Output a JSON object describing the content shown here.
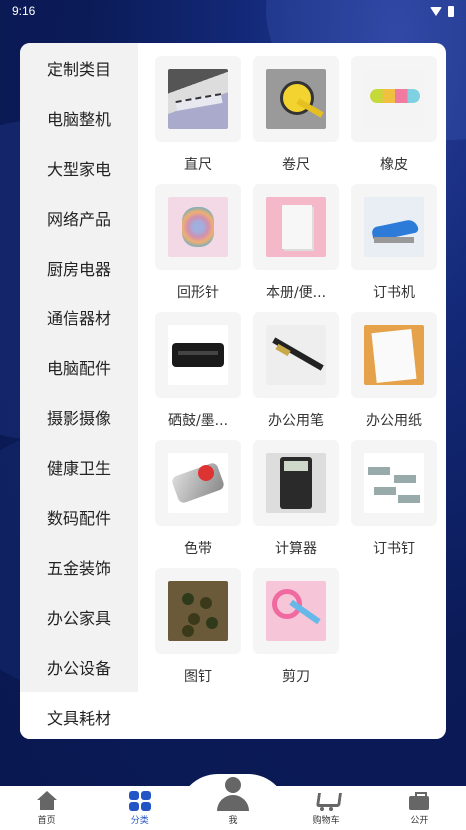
{
  "status_bar": {
    "time": "9:16"
  },
  "sidebar": {
    "items": [
      {
        "label": "定制类目"
      },
      {
        "label": "电脑整机"
      },
      {
        "label": "大型家电"
      },
      {
        "label": "网络产品"
      },
      {
        "label": "厨房电器"
      },
      {
        "label": "通信器材"
      },
      {
        "label": "电脑配件"
      },
      {
        "label": "摄影摄像"
      },
      {
        "label": "健康卫生"
      },
      {
        "label": "数码配件"
      },
      {
        "label": "五金装饰"
      },
      {
        "label": "办公家具"
      },
      {
        "label": "办公设备"
      },
      {
        "label": "文具耗材"
      }
    ],
    "active": "文具耗材"
  },
  "products": [
    {
      "label": "直尺",
      "icon": "ruler-image"
    },
    {
      "label": "卷尺",
      "icon": "tape-measure-image"
    },
    {
      "label": "橡皮",
      "icon": "eraser-image"
    },
    {
      "label": "回形针",
      "icon": "paper-clip-image"
    },
    {
      "label": "本册/便...",
      "icon": "notebook-image"
    },
    {
      "label": "订书机",
      "icon": "stapler-image"
    },
    {
      "label": "硒鼓/墨...",
      "icon": "toner-cartridge-image"
    },
    {
      "label": "办公用笔",
      "icon": "pen-image"
    },
    {
      "label": "办公用纸",
      "icon": "paper-image"
    },
    {
      "label": "色带",
      "icon": "ribbon-image"
    },
    {
      "label": "计算器",
      "icon": "calculator-image"
    },
    {
      "label": "订书钉",
      "icon": "staples-image"
    },
    {
      "label": "图钉",
      "icon": "thumbtack-image"
    },
    {
      "label": "剪刀",
      "icon": "scissors-image"
    }
  ],
  "tabbar": {
    "home": "首页",
    "category": "分类",
    "me": "我",
    "cart": "购物车",
    "public": "公开"
  },
  "colors": {
    "accent": "#2455c6",
    "background": "#0c1d5e"
  }
}
